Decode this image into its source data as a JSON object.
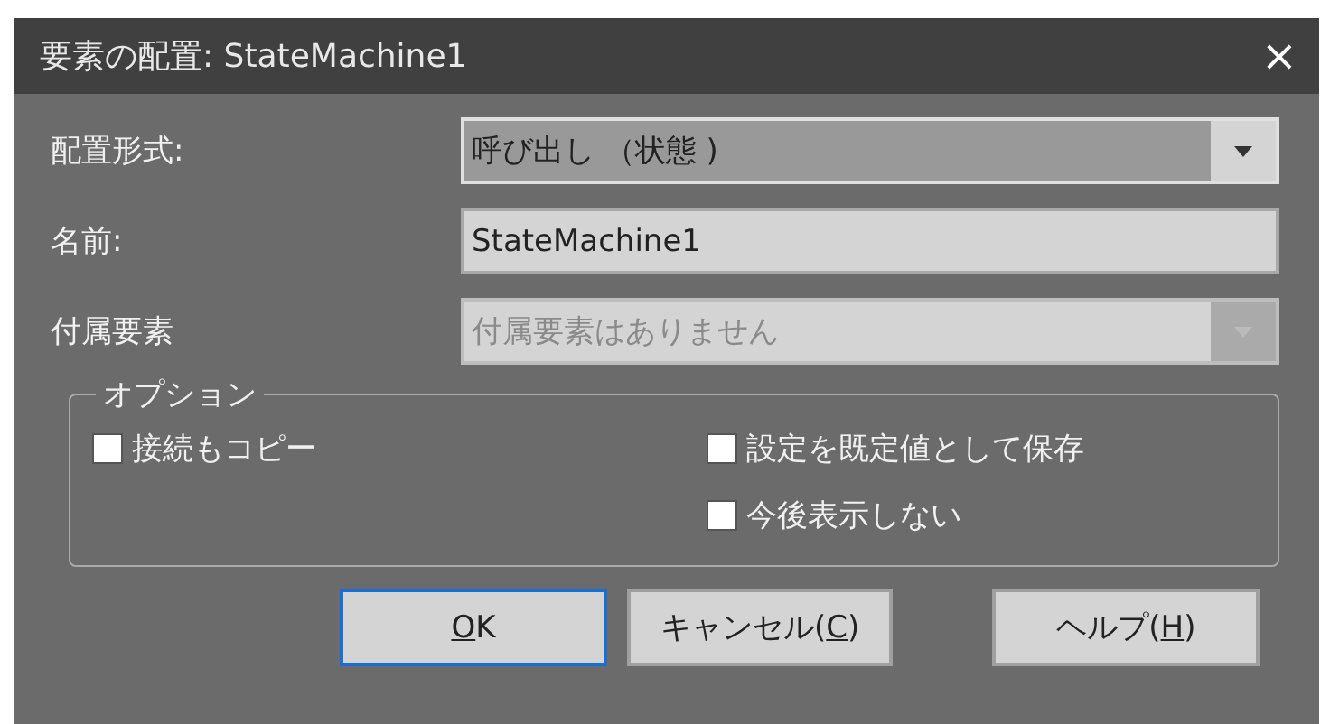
{
  "window": {
    "title": "要素の配置: StateMachine1",
    "close": "×"
  },
  "fields": [
    {
      "label": "配置形式:",
      "kind": "dropdown",
      "value": "呼び出し （状態 )",
      "disabled": false,
      "focused": true
    },
    {
      "label": "名前:",
      "kind": "text",
      "value": "StateMachine1",
      "disabled": false,
      "focused": false
    },
    {
      "label": "付属要素",
      "kind": "dropdown",
      "value": "付属要素はありません",
      "disabled": true,
      "focused": false
    }
  ],
  "options": {
    "title": "オプション",
    "columns": [
      [
        {
          "label": "接続もコピー",
          "checked": false
        }
      ],
      [
        {
          "label": "設定を既定値として保存",
          "checked": false
        },
        {
          "label": "今後表示しない",
          "checked": false
        }
      ]
    ]
  },
  "buttons": [
    {
      "key": "O",
      "after": "K",
      "focused": true
    },
    {
      "before": "キャンセル(",
      "key": "C",
      "after": ")",
      "focused": false
    },
    {
      "before": "ヘルプ(",
      "key": "H",
      "after": ")",
      "focused": false
    }
  ]
}
